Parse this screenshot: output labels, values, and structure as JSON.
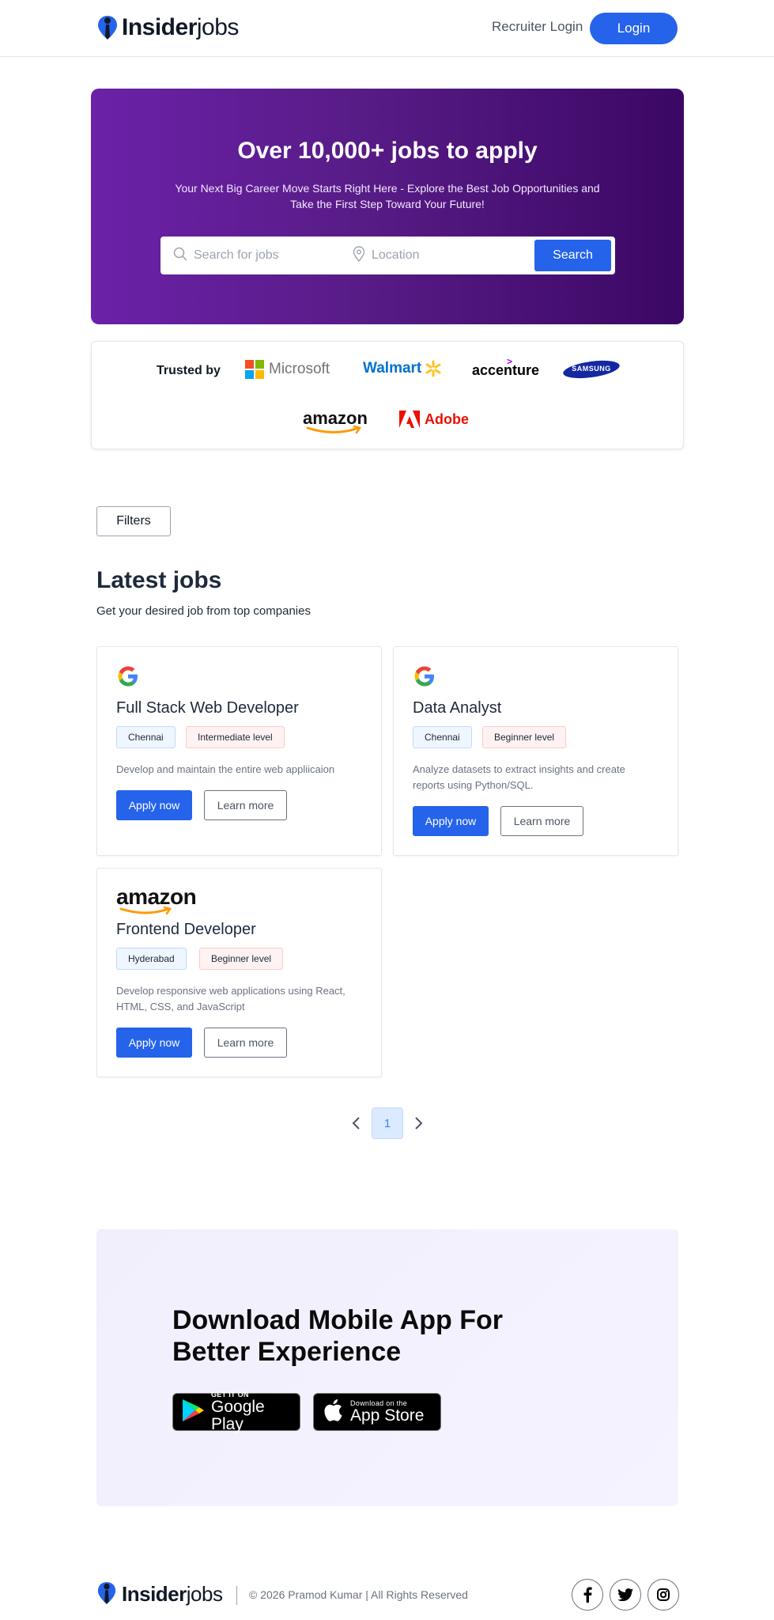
{
  "header": {
    "logo_bold": "Insider",
    "logo_light": "jobs",
    "recruiter_login": "Recruiter Login",
    "login": "Login"
  },
  "hero": {
    "title": "Over 10,000+ jobs to apply",
    "subtitle": "Your Next Big Career Move Starts Right Here - Explore the Best Job Opportunities and Take the First Step Toward Your Future!",
    "search_placeholder": "Search for jobs",
    "location_placeholder": "Location",
    "search_button": "Search"
  },
  "trusted": {
    "label": "Trusted by",
    "brands": [
      "Microsoft",
      "Walmart",
      "accenture",
      "SAMSUNG",
      "amazon",
      "Adobe"
    ]
  },
  "filters_label": "Filters",
  "jobs_section": {
    "title": "Latest jobs",
    "subtitle": "Get your desired job from top companies",
    "apply_label": "Apply now",
    "learn_label": "Learn more",
    "jobs": [
      {
        "company_icon": "google-logo",
        "title": "Full Stack Web Developer",
        "location": "Chennai",
        "level": "Intermediate level",
        "description": "Develop and maintain the entire web appliicaion"
      },
      {
        "company_icon": "google-logo",
        "title": "Data Analyst",
        "location": "Chennai",
        "level": "Beginner level",
        "description": "Analyze datasets to extract insights and create reports using Python/SQL."
      },
      {
        "company_icon": "amazon-logo",
        "company_name": "amazon",
        "title": "Frontend Developer",
        "location": "Hyderabad",
        "level": "Beginner level",
        "description": "Develop responsive web applications using React, HTML, CSS, and JavaScript"
      }
    ]
  },
  "pagination": {
    "current_page": "1",
    "prev_icon": "chevron-left-icon",
    "next_icon": "chevron-right-icon"
  },
  "app_banner": {
    "title": "Download Mobile App For Better Experience",
    "google_play_small": "GET IT ON",
    "google_play_big": "Google Play",
    "app_store_small": "Download on the",
    "app_store_big": "App Store"
  },
  "footer": {
    "logo_bold": "Insider",
    "logo_light": "jobs",
    "copyright": "© 2026 Pramod Kumar | All Rights Reserved",
    "social_icons": [
      "facebook-icon",
      "twitter-icon",
      "instagram-icon"
    ]
  },
  "colors": {
    "accent": "#2563eb",
    "hero_start": "#6b21a8",
    "hero_end": "#3b0764"
  }
}
